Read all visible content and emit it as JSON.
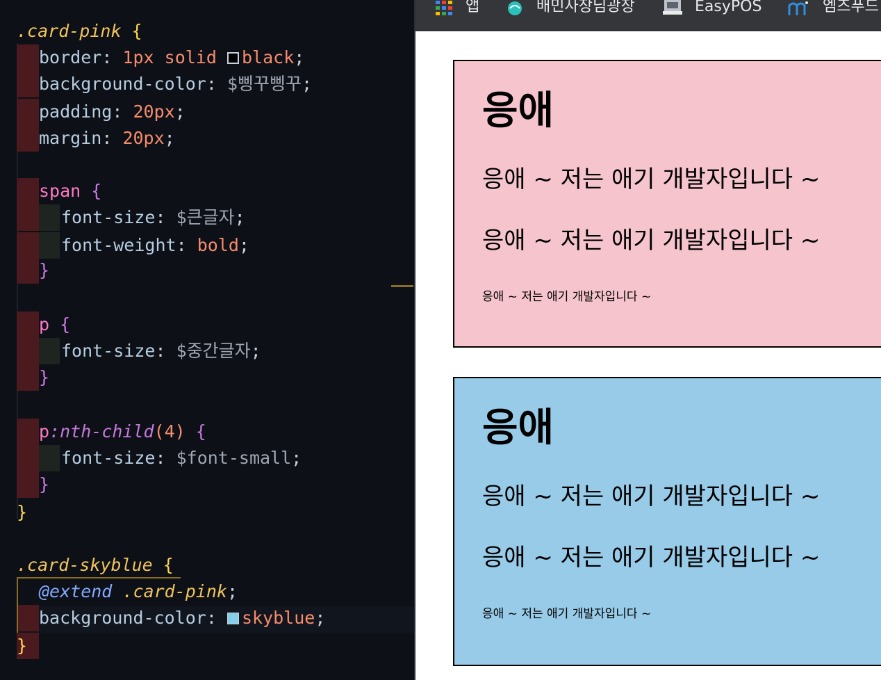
{
  "editor": {
    "code": {
      "l1_sel": ".card-pink",
      "l1_brace": " {",
      "l2_prop": "border",
      "l2_v1": "1px",
      "l2_v2": "solid",
      "l2_v3": "black",
      "l3_prop": "background-color",
      "l3_val": "$삥꾸삥꾸",
      "l4_prop": "padding",
      "l4_val": "20px",
      "l5_prop": "margin",
      "l5_val": "20px",
      "l7_tag": "span",
      "l8_prop": "font-size",
      "l8_val": "$큰글자",
      "l9_prop": "font-weight",
      "l9_val": "bold",
      "l12_tag": "p",
      "l13_prop": "font-size",
      "l13_val": "$중간글자",
      "l16_tag": "p",
      "l16_pseudo": ":nth-child",
      "l16_arg": "(4)",
      "l17_prop": "font-size",
      "l17_val": "$font-small",
      "l21_sel": ".card-skyblue",
      "l22_at": "@extend",
      "l22_sel": ".card-pink",
      "l23_prop": "background-color",
      "l23_val": "skyblue",
      "open": "{",
      "close": "}",
      "colon": ":",
      "semi": ";"
    },
    "swatch_colors": {
      "black": "#000000",
      "skyblue": "#87ceeb"
    }
  },
  "browser": {
    "bookmarks": [
      {
        "label": "앱",
        "icon": "apps-grid-icon"
      },
      {
        "label": "배민사장님광장",
        "icon": "baemin-icon"
      },
      {
        "label": "EasyPOS",
        "icon": "easypos-icon"
      },
      {
        "label": "엠즈푸드",
        "icon": "mz-icon"
      }
    ],
    "cards": [
      {
        "background": "#f6c4cd",
        "heading": "응애",
        "lines": [
          "응애 ~ 저는 애기 개발자입니다 ~",
          "응애 ~ 저는 애기 개발자입니다 ~"
        ],
        "small": "응애 ~ 저는 애기 개발자입니다 ~"
      },
      {
        "background": "#98cbe8",
        "heading": "응애",
        "lines": [
          "응애 ~ 저는 애기 개발자입니다 ~",
          "응애 ~ 저는 애기 개발자입니다 ~"
        ],
        "small": "응애 ~ 저는 애기 개발자입니다 ~"
      }
    ]
  }
}
